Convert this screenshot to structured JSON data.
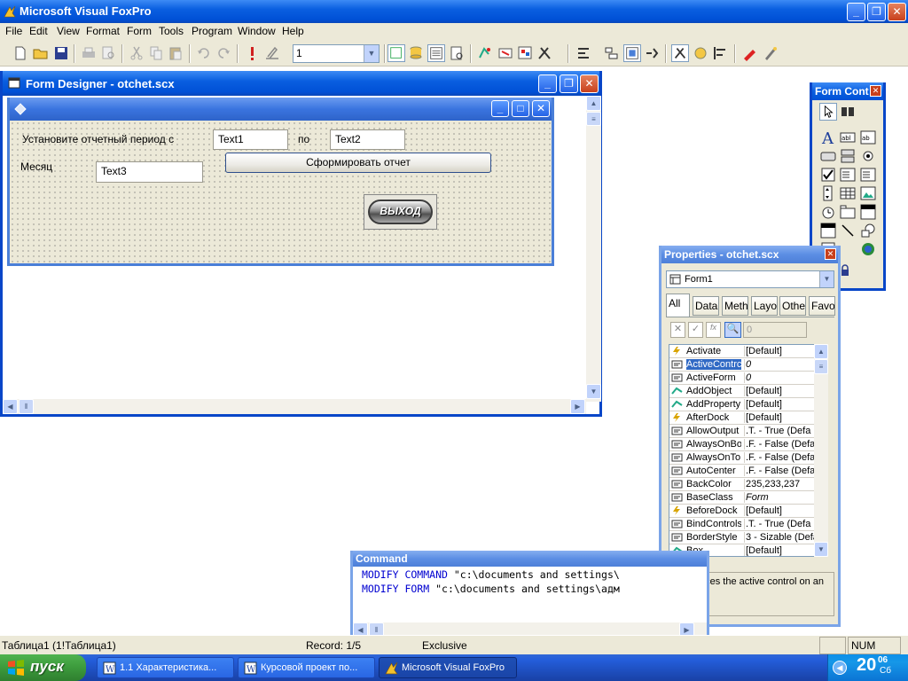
{
  "app": {
    "title": "Microsoft Visual FoxPro"
  },
  "menu": [
    "File",
    "Edit",
    "View",
    "Format",
    "Form",
    "Tools",
    "Program",
    "Window",
    "Help"
  ],
  "toolbar": {
    "zoom_value": "1"
  },
  "form_designer": {
    "title": "Form Designer - otchet.scx",
    "label_period": "Установите отчетный период с",
    "label_to": "по",
    "label_month": "Месяц",
    "text1": "Text1",
    "text2": "Text2",
    "text3": "Text3",
    "report_button": "Сформировать отчет",
    "exit_button": "ВЫХОД"
  },
  "form_controls": {
    "title": "Form Cont"
  },
  "properties": {
    "title": "Properties - otchet.scx",
    "object": "Form1",
    "tabs": [
      "All",
      "Data",
      "Metho",
      "Layou",
      "Other",
      "Favo"
    ],
    "value_box": "0",
    "rows": [
      {
        "name": "Activate",
        "value": "[Default]"
      },
      {
        "name": "ActiveContrc",
        "value": "0"
      },
      {
        "name": "ActiveForm",
        "value": "0"
      },
      {
        "name": "AddObject",
        "value": "[Default]"
      },
      {
        "name": "AddProperty",
        "value": "[Default]"
      },
      {
        "name": "AfterDock",
        "value": "[Default]"
      },
      {
        "name": "AllowOutput",
        "value": ".T. - True (Defa"
      },
      {
        "name": "AlwaysOnBo",
        "value": ".F. - False (Defa"
      },
      {
        "name": "AlwaysOnTo",
        "value": ".F. - False (Defa"
      },
      {
        "name": "AutoCenter",
        "value": ".F. - False (Defa"
      },
      {
        "name": "BackColor",
        "value": "235,233,237"
      },
      {
        "name": "BaseClass",
        "value": "Form"
      },
      {
        "name": "BeforeDock",
        "value": "[Default]"
      },
      {
        "name": "BindControls",
        "value": ".T. - True (Defa"
      },
      {
        "name": "BorderStyle",
        "value": "3 - Sizable (Defa"
      },
      {
        "name": "Box",
        "value": "[Default]"
      }
    ],
    "description": "References the active control on an object."
  },
  "command": {
    "title": "Command",
    "lines": [
      {
        "kw": "MODIFY COMMAND",
        "arg": " \"c:\\documents and settings\\"
      },
      {
        "kw": "MODIFY FORM",
        "arg": " \"c:\\documents and settings\\адм"
      }
    ]
  },
  "status": {
    "table": "Таблица1 (1!Таблица1)",
    "record": "Record: 1/5",
    "exclusive": "Exclusive",
    "num": "NUM"
  },
  "taskbar": {
    "start": "пуск",
    "tasks": [
      "1.1 Характеристика...",
      "Курсовой проект по...",
      "Microsoft Visual FoxPro"
    ],
    "clock": "20",
    "clock_sub": "06",
    "day": "Сб"
  },
  "colors": {
    "xp_blue": "#0a5fe0",
    "face": "#ece9d8",
    "selection": "#316ac5",
    "start_green": "#3c9a3c"
  }
}
